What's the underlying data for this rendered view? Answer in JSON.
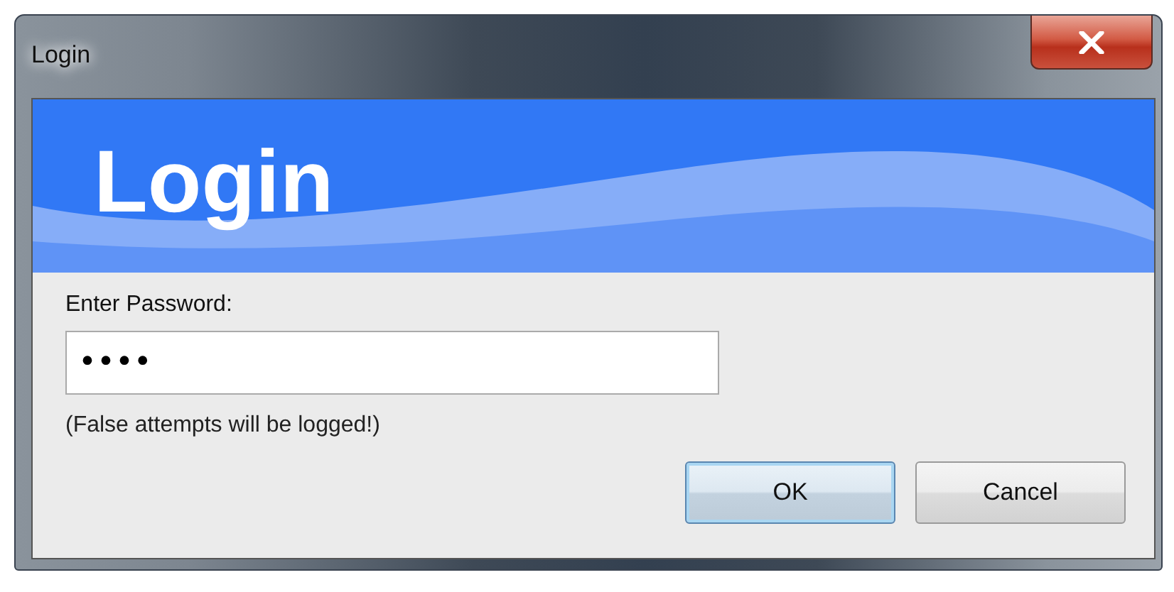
{
  "window": {
    "title": "Login"
  },
  "banner": {
    "title": "Login"
  },
  "password": {
    "label": "Enter Password:",
    "value": "••••"
  },
  "note": "(False attempts will be logged!)",
  "buttons": [
    {
      "label": "OK",
      "default": true
    },
    {
      "label": "Cancel",
      "default": false
    }
  ]
}
